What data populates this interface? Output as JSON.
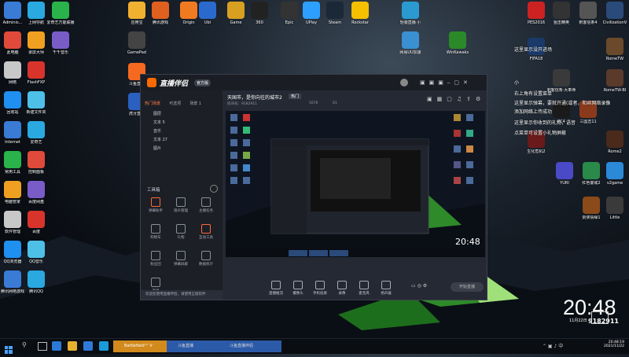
{
  "desktop_left": [
    {
      "name": "administrator",
      "label": "Adminis..."
    },
    {
      "name": "ie-network",
      "label": "上网导航"
    },
    {
      "name": "love-music",
      "label": "爱奇艺万能联播"
    },
    {
      "name": "my-computer",
      "label": "此电脑"
    },
    {
      "name": "record-master",
      "label": "录屏大师"
    },
    {
      "name": "qianqian",
      "label": "千千音乐\n(原百度音乐)"
    },
    {
      "name": "network",
      "label": "网络"
    },
    {
      "name": "flashfxp",
      "label": "FlashFXP"
    },
    {
      "name": "recycle-bin",
      "label": "回收站"
    },
    {
      "name": "new-folder",
      "label": "新建文件夹"
    },
    {
      "name": "internet-explorer",
      "label": "Internet\nExplorer"
    },
    {
      "name": "iqiyi",
      "label": "爱奇艺"
    },
    {
      "name": "common-tools",
      "label": "常用工具"
    },
    {
      "name": "control-panel",
      "label": "控制面板"
    },
    {
      "name": "pc-manager",
      "label": "电脑管家"
    },
    {
      "name": "baidu-netdisk",
      "label": "百度网盘"
    },
    {
      "name": "software-manager",
      "label": "软件管理"
    },
    {
      "name": "feishu",
      "label": "百度"
    },
    {
      "name": "qq-browser",
      "label": "QQ浏览器"
    },
    {
      "name": "qq-music",
      "label": "QQ音乐"
    },
    {
      "name": "tencent-qq-net",
      "label": "腾讯网络游戏"
    },
    {
      "name": "tencent-qq",
      "label": "腾讯QQ"
    }
  ],
  "desktop_top": [
    {
      "name": "game-store",
      "label": "应用宝"
    },
    {
      "name": "tencent-games",
      "label": "腾讯游戏\n下载助手"
    },
    {
      "name": "origin",
      "label": "Origin"
    },
    {
      "name": "ubi",
      "label": "Ubi"
    },
    {
      "name": "gane",
      "label": "Game"
    },
    {
      "name": "360-game",
      "label": "360\nWargam..."
    },
    {
      "name": "epic",
      "label": "Epic\nGames\nLauncher"
    },
    {
      "name": "uplay",
      "label": "UPlay"
    },
    {
      "name": "steam",
      "label": "Steam"
    },
    {
      "name": "rockstar",
      "label": "Rockstar\nGames..."
    },
    {
      "name": "game-live",
      "label": "轻装直播 小\n组件"
    },
    {
      "name": "gamepad-helper",
      "label": "GamePad"
    },
    {
      "name": "douyu-live",
      "label": "斗鱼直播"
    },
    {
      "name": "game-client",
      "label": "虎牙直播"
    },
    {
      "name": "wechat-helper",
      "label": "网易UU加速"
    },
    {
      "name": "winkawaks",
      "label": "WinKawaks"
    }
  ],
  "desktop_right": [
    {
      "name": "pes2016",
      "label": "PES2016"
    },
    {
      "name": "shoot-hero",
      "label": "狙击精英"
    },
    {
      "name": "assassin-creed",
      "label": "刺客信条4"
    },
    {
      "name": "civ5",
      "label": "CivilizationV"
    },
    {
      "name": "fifa18",
      "label": "FIFA18"
    },
    {
      "name": "rome-tw",
      "label": "RomeTW"
    },
    {
      "name": "ac-unity",
      "label": "刺客信条·大革命"
    },
    {
      "name": "rome-tw2",
      "label": "RomeTW-BI"
    },
    {
      "name": "fc4",
      "label": "FC4"
    },
    {
      "name": "3k",
      "label": "三国志11"
    },
    {
      "name": "resident",
      "label": "生化危机2"
    },
    {
      "name": "rome2",
      "label": "Rome2"
    },
    {
      "name": "yuri",
      "label": "YURI"
    },
    {
      "name": "ra2",
      "label": "红色警戒2"
    },
    {
      "name": "v2game",
      "label": "v2game"
    },
    {
      "name": "xixi",
      "label": "剑侠情缘1"
    },
    {
      "name": "nightmare",
      "label": "Little\nNightmar..."
    }
  ],
  "chat": [
    "这里显示没开进场",
    "小",
    "右上角有设置菜单",
    "这里显示弹幕，要就开通(或者，和丝网络录像",
    "添加网络上传成功",
    "这里显示你收到的礼物，语音",
    "点菜单可设置小礼物屏蔽"
  ],
  "app": {
    "logo": "直播伴侣",
    "version": "官方版",
    "tabs": [
      "热门场景",
      "可选项",
      "场景 1"
    ],
    "layers": [
      "图层",
      "文本 5",
      "音乐",
      "文本 27",
      "图片"
    ],
    "tool_section": "工具箱",
    "tools": [
      "弹幕助手",
      "观众管理",
      "主播任务",
      "购物车",
      "礼物",
      "互动工具",
      "粉丝团",
      "弹幕屏蔽",
      "数据统计",
      "连线"
    ],
    "stream_title": "天国市，是你向往的城市2",
    "stream_tag": "热门",
    "meta_id": "房间号：9182911",
    "meta_online": "1676",
    "meta_likes": "61",
    "bottom_tools": [
      "直播推流",
      "摄像头",
      "手机投屏",
      "录像",
      "麦克风",
      "扬声器"
    ],
    "start_btn": "开始直播",
    "notice": "欢迎您使用直播伴侣，请使用正版软件"
  },
  "clock": {
    "time": "20:48",
    "date": "11月22日",
    "room": "9182911",
    "tray_time": "20:48:19",
    "tray_date": "2021/11/22"
  },
  "taskbar": {
    "items": [
      "Battlefield™ V",
      "斗鱼直播",
      "斗鱼直播伴侣"
    ]
  }
}
